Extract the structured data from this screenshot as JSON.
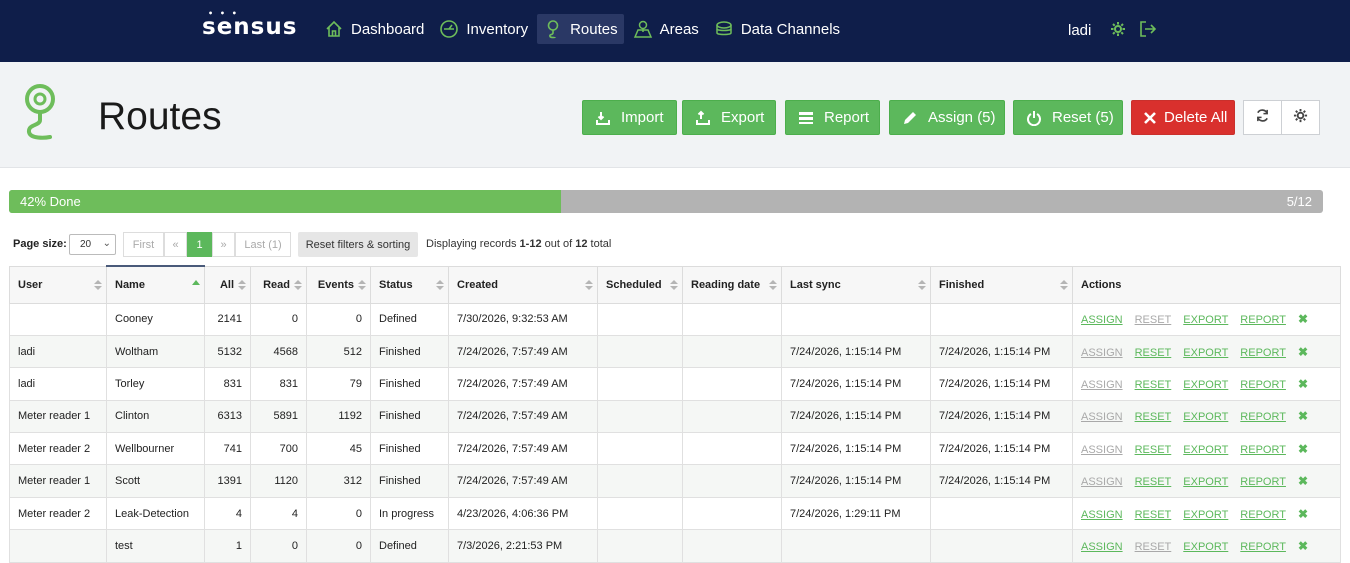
{
  "app": {
    "logo": "sensus",
    "nav": [
      {
        "label": "Dashboard",
        "icon": "home-icon"
      },
      {
        "label": "Inventory",
        "icon": "meter-icon"
      },
      {
        "label": "Routes",
        "icon": "route-pin-icon",
        "active": true
      },
      {
        "label": "Areas",
        "icon": "map-area-icon"
      },
      {
        "label": "Data Channels",
        "icon": "data-channel-icon"
      }
    ],
    "user": "ladi"
  },
  "header": {
    "title": "Routes",
    "buttons": {
      "import": "Import",
      "export": "Export",
      "report": "Report",
      "assign": "Assign (5)",
      "reset": "Reset (5)",
      "delete_all": "Delete All"
    }
  },
  "progress": {
    "label": "42% Done",
    "count": "5/12",
    "fraction": 0.42,
    "fill_color": "#6ebd5b"
  },
  "pager": {
    "page_size_label": "Page size:",
    "page_size": "20",
    "first": "First",
    "prev": "«",
    "current": "1",
    "next": "»",
    "last": "Last (1)",
    "reset_filters": "Reset filters & sorting",
    "records_prefix": "Displaying records ",
    "records_range": "1-12",
    "records_mid": " out of ",
    "records_total": "12",
    "records_suffix": " total"
  },
  "table": {
    "columns": [
      "User",
      "Name",
      "All",
      "Read",
      "Events",
      "Status",
      "Created",
      "Scheduled",
      "Reading date",
      "Last sync",
      "Finished",
      "Actions"
    ],
    "action_labels": {
      "assign": "ASSIGN",
      "reset": "RESET",
      "export": "EXPORT",
      "report": "REPORT",
      "delete": "✖"
    },
    "rows": [
      {
        "user": "",
        "name": "Cooney",
        "all": "2141",
        "read": "0",
        "events": "0",
        "status": "Defined",
        "created": "7/30/2026, 9:32:53 AM",
        "scheduled": "",
        "reading_date": "",
        "last_sync": "",
        "finished": "",
        "assign_on": true,
        "reset_on": false
      },
      {
        "user": "ladi",
        "name": "Woltham",
        "all": "5132",
        "read": "4568",
        "events": "512",
        "status": "Finished",
        "created": "7/24/2026, 7:57:49 AM",
        "scheduled": "",
        "reading_date": "",
        "last_sync": "7/24/2026, 1:15:14 PM",
        "finished": "7/24/2026, 1:15:14 PM",
        "assign_on": false,
        "reset_on": true
      },
      {
        "user": "ladi",
        "name": "Torley",
        "all": "831",
        "read": "831",
        "events": "79",
        "status": "Finished",
        "created": "7/24/2026, 7:57:49 AM",
        "scheduled": "",
        "reading_date": "",
        "last_sync": "7/24/2026, 1:15:14 PM",
        "finished": "7/24/2026, 1:15:14 PM",
        "assign_on": false,
        "reset_on": true
      },
      {
        "user": "Meter reader 1",
        "name": "Clinton",
        "all": "6313",
        "read": "5891",
        "events": "1192",
        "status": "Finished",
        "created": "7/24/2026, 7:57:49 AM",
        "scheduled": "",
        "reading_date": "",
        "last_sync": "7/24/2026, 1:15:14 PM",
        "finished": "7/24/2026, 1:15:14 PM",
        "assign_on": false,
        "reset_on": true
      },
      {
        "user": "Meter reader 2",
        "name": "Wellbourner",
        "all": "741",
        "read": "700",
        "events": "45",
        "status": "Finished",
        "created": "7/24/2026, 7:57:49 AM",
        "scheduled": "",
        "reading_date": "",
        "last_sync": "7/24/2026, 1:15:14 PM",
        "finished": "7/24/2026, 1:15:14 PM",
        "assign_on": false,
        "reset_on": true
      },
      {
        "user": "Meter reader 1",
        "name": "Scott",
        "all": "1391",
        "read": "1120",
        "events": "312",
        "status": "Finished",
        "created": "7/24/2026, 7:57:49 AM",
        "scheduled": "",
        "reading_date": "",
        "last_sync": "7/24/2026, 1:15:14 PM",
        "finished": "7/24/2026, 1:15:14 PM",
        "assign_on": false,
        "reset_on": true
      },
      {
        "user": "Meter reader 2",
        "name": "Leak-Detection",
        "all": "4",
        "read": "4",
        "events": "0",
        "status": "In progress",
        "created": "4/23/2026, 4:06:36 PM",
        "scheduled": "",
        "reading_date": "",
        "last_sync": "7/24/2026, 1:29:11 PM",
        "finished": "",
        "assign_on": true,
        "reset_on": true
      },
      {
        "user": "",
        "name": "test",
        "all": "1",
        "read": "0",
        "events": "0",
        "status": "Defined",
        "created": "7/3/2026, 2:21:53 PM",
        "scheduled": "",
        "reading_date": "",
        "last_sync": "",
        "finished": "",
        "assign_on": true,
        "reset_on": false
      }
    ]
  },
  "colors": {
    "nav_bg": "#0f1e4a",
    "green": "#5cb85c",
    "red": "#d9302d",
    "accent_icon": "#6ebd5b"
  }
}
